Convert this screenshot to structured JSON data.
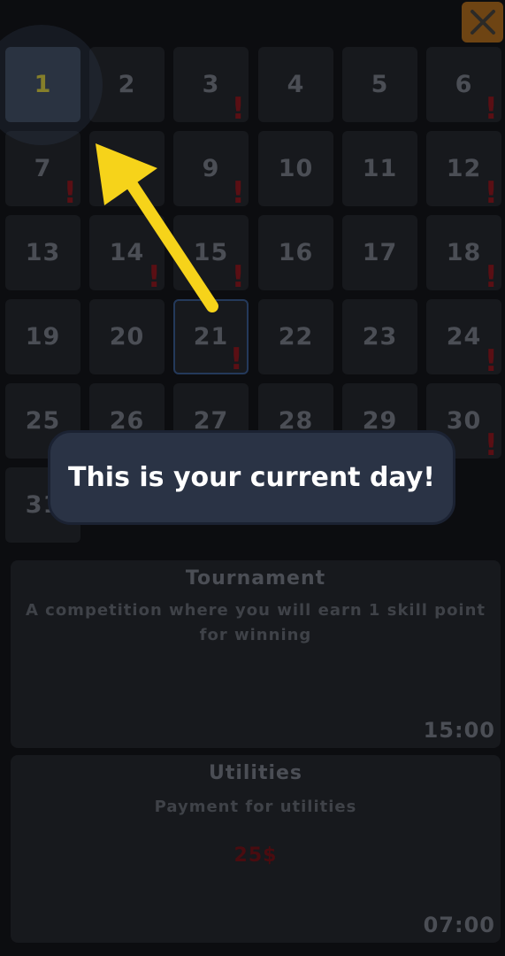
{
  "close_button": {
    "icon": "close-icon"
  },
  "calendar": {
    "current_day": 1,
    "days": [
      {
        "n": "1",
        "mark": "",
        "today": true
      },
      {
        "n": "2",
        "mark": ""
      },
      {
        "n": "3",
        "mark": "!"
      },
      {
        "n": "4",
        "mark": ""
      },
      {
        "n": "5",
        "mark": ""
      },
      {
        "n": "6",
        "mark": "!"
      },
      {
        "n": "7",
        "mark": "!"
      },
      {
        "n": "8",
        "mark": ""
      },
      {
        "n": "9",
        "mark": "!"
      },
      {
        "n": "10",
        "mark": ""
      },
      {
        "n": "11",
        "mark": ""
      },
      {
        "n": "12",
        "mark": "!"
      },
      {
        "n": "13",
        "mark": ""
      },
      {
        "n": "14",
        "mark": "!"
      },
      {
        "n": "15",
        "mark": "!"
      },
      {
        "n": "16",
        "mark": ""
      },
      {
        "n": "17",
        "mark": ""
      },
      {
        "n": "18",
        "mark": "!"
      },
      {
        "n": "19",
        "mark": ""
      },
      {
        "n": "20",
        "mark": ""
      },
      {
        "n": "21",
        "mark": "!",
        "selected": true
      },
      {
        "n": "22",
        "mark": ""
      },
      {
        "n": "23",
        "mark": ""
      },
      {
        "n": "24",
        "mark": "!"
      },
      {
        "n": "25",
        "mark": ""
      },
      {
        "n": "26",
        "mark": ""
      },
      {
        "n": "27",
        "mark": ""
      },
      {
        "n": "28",
        "mark": ""
      },
      {
        "n": "29",
        "mark": ""
      },
      {
        "n": "30",
        "mark": "!"
      },
      {
        "n": "31",
        "mark": ""
      }
    ]
  },
  "events": [
    {
      "title": "Tournament",
      "description": "A competition where you will earn 1 skill point for winning",
      "amount": "",
      "time": "15:00"
    },
    {
      "title": "Utilities",
      "description": "Payment for utilities",
      "amount": "25$",
      "time": "07:00"
    }
  ],
  "tutorial": {
    "message": "This is your current day!",
    "arrow_color": "#f6d31a"
  }
}
